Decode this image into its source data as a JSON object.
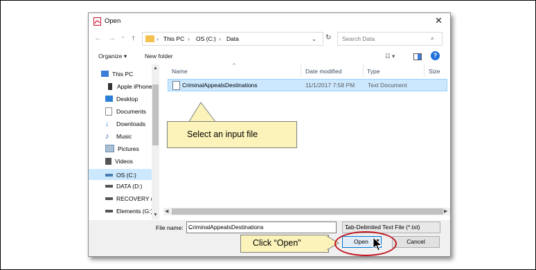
{
  "window": {
    "title": "Open",
    "close_glyph": "✕",
    "title_icon": "pdf-app-icon"
  },
  "nav": {
    "back_glyph": "←",
    "forward_glyph": "→",
    "recent_glyph": "⌄",
    "up_glyph": "↑",
    "breadcrumb": [
      "This PC",
      "OS (C:)",
      "Data"
    ],
    "separator": "›",
    "dropdown_glyph": "⌄",
    "refresh_glyph": "↻",
    "search_placeholder": "Search Data",
    "search_glyph": "⌕"
  },
  "toolbar": {
    "organize_label": "Organize ▾",
    "new_folder_label": "New folder",
    "view_label": "☷ ▾",
    "help_label": "?"
  },
  "sidebar": {
    "items": [
      {
        "label": "This PC",
        "icon": "monitor-icon",
        "color": "#3b7dd8"
      },
      {
        "label": "Apple iPhone",
        "icon": "phone-icon",
        "color": "#333333"
      },
      {
        "label": "Desktop",
        "icon": "desktop-icon",
        "color": "#2a7fd4"
      },
      {
        "label": "Documents",
        "icon": "documents-icon",
        "color": "#8a8a8a"
      },
      {
        "label": "Downloads",
        "icon": "download-icon",
        "color": "#2a7fd4"
      },
      {
        "label": "Music",
        "icon": "music-icon",
        "color": "#2a5fb0"
      },
      {
        "label": "Pictures",
        "icon": "pictures-icon",
        "color": "#6f8fb0"
      },
      {
        "label": "Videos",
        "icon": "videos-icon",
        "color": "#555555"
      },
      {
        "label": "OS (C:)",
        "icon": "drive-icon",
        "color": "#4a7ab0"
      },
      {
        "label": "DATA (D:)",
        "icon": "drive-icon",
        "color": "#555555"
      },
      {
        "label": "RECOVERY (E",
        "icon": "drive-icon",
        "color": "#555555"
      },
      {
        "label": "Elements (G:)",
        "icon": "drive-icon",
        "color": "#555555"
      }
    ]
  },
  "columns": {
    "name": "Name",
    "date": "Date modified",
    "type": "Type",
    "size": "Size",
    "sort_glyph": "^"
  },
  "files": [
    {
      "name": "CriminalAppealsDestinations",
      "date": "11/1/2017 7:58 PM",
      "type": "Text Document",
      "size": ""
    }
  ],
  "bottom": {
    "file_name_label": "File name:",
    "file_name_value": "CriminalAppealsDestinations",
    "file_type_value": "Tab-Delimited Text File (*.txt)",
    "open_label": "Open",
    "cancel_label": "Cancel",
    "dropdown_glyph": "⌄"
  },
  "annotations": {
    "callout_select": "Select an input file",
    "callout_open": "Click “Open”",
    "callout_color": "#fbf3b9",
    "highlight_color": "#c0141e"
  },
  "colors": {
    "selection": "#cce8ff",
    "accent": "#0078d7"
  }
}
